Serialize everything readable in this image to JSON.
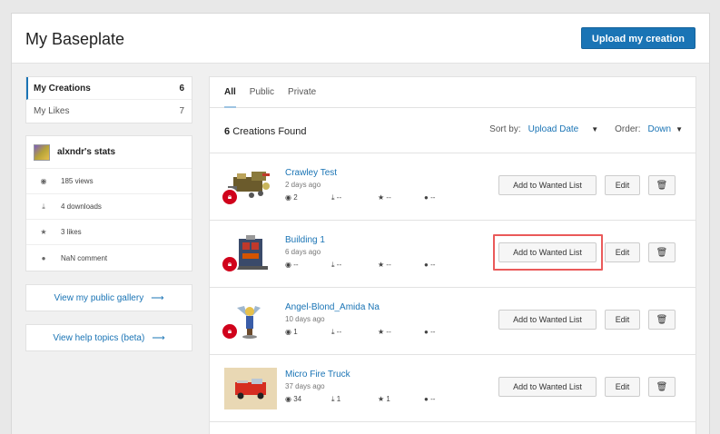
{
  "header": {
    "title": "My Baseplate",
    "upload_label": "Upload my creation",
    "accent": "#1a74b5"
  },
  "sidebar": {
    "nav": [
      {
        "label": "My Creations",
        "count": "6",
        "active": true
      },
      {
        "label": "My Likes",
        "count": "7",
        "active": false
      }
    ],
    "stats": {
      "title": "alxndr's stats",
      "rows": [
        {
          "icon": "eye-icon",
          "label": "185 views"
        },
        {
          "icon": "download-icon",
          "label": "4 downloads"
        },
        {
          "icon": "star-icon",
          "label": "3 likes"
        },
        {
          "icon": "comment-icon",
          "label": "NaN comment"
        }
      ]
    },
    "gallery_link": "View my public gallery",
    "help_link": "View help topics (beta)"
  },
  "main": {
    "tabs": [
      {
        "label": "All",
        "active": true
      },
      {
        "label": "Public",
        "active": false
      },
      {
        "label": "Private",
        "active": false
      }
    ],
    "found_count": "6",
    "found_text": "Creations Found",
    "sort_label": "Sort by:",
    "sort_value": "Upload Date",
    "order_label": "Order:",
    "order_value": "Down",
    "actions": {
      "wanted_label": "Add to Wanted List",
      "edit_label": "Edit"
    },
    "creations": [
      {
        "title": "Crawley Test",
        "age": "2 days ago",
        "views": "2",
        "downloads": "--",
        "likes": "--",
        "comments": "--",
        "private": true,
        "highlighted": false
      },
      {
        "title": "Building 1",
        "age": "6 days ago",
        "views": "--",
        "downloads": "--",
        "likes": "--",
        "comments": "--",
        "private": true,
        "highlighted": true
      },
      {
        "title": "Angel-Blond_Amida Na",
        "age": "10 days ago",
        "views": "1",
        "downloads": "--",
        "likes": "--",
        "comments": "--",
        "private": true,
        "highlighted": false
      },
      {
        "title": "Micro Fire Truck",
        "age": "37 days ago",
        "views": "34",
        "downloads": "1",
        "likes": "1",
        "comments": "--",
        "private": false,
        "highlighted": false
      }
    ]
  }
}
